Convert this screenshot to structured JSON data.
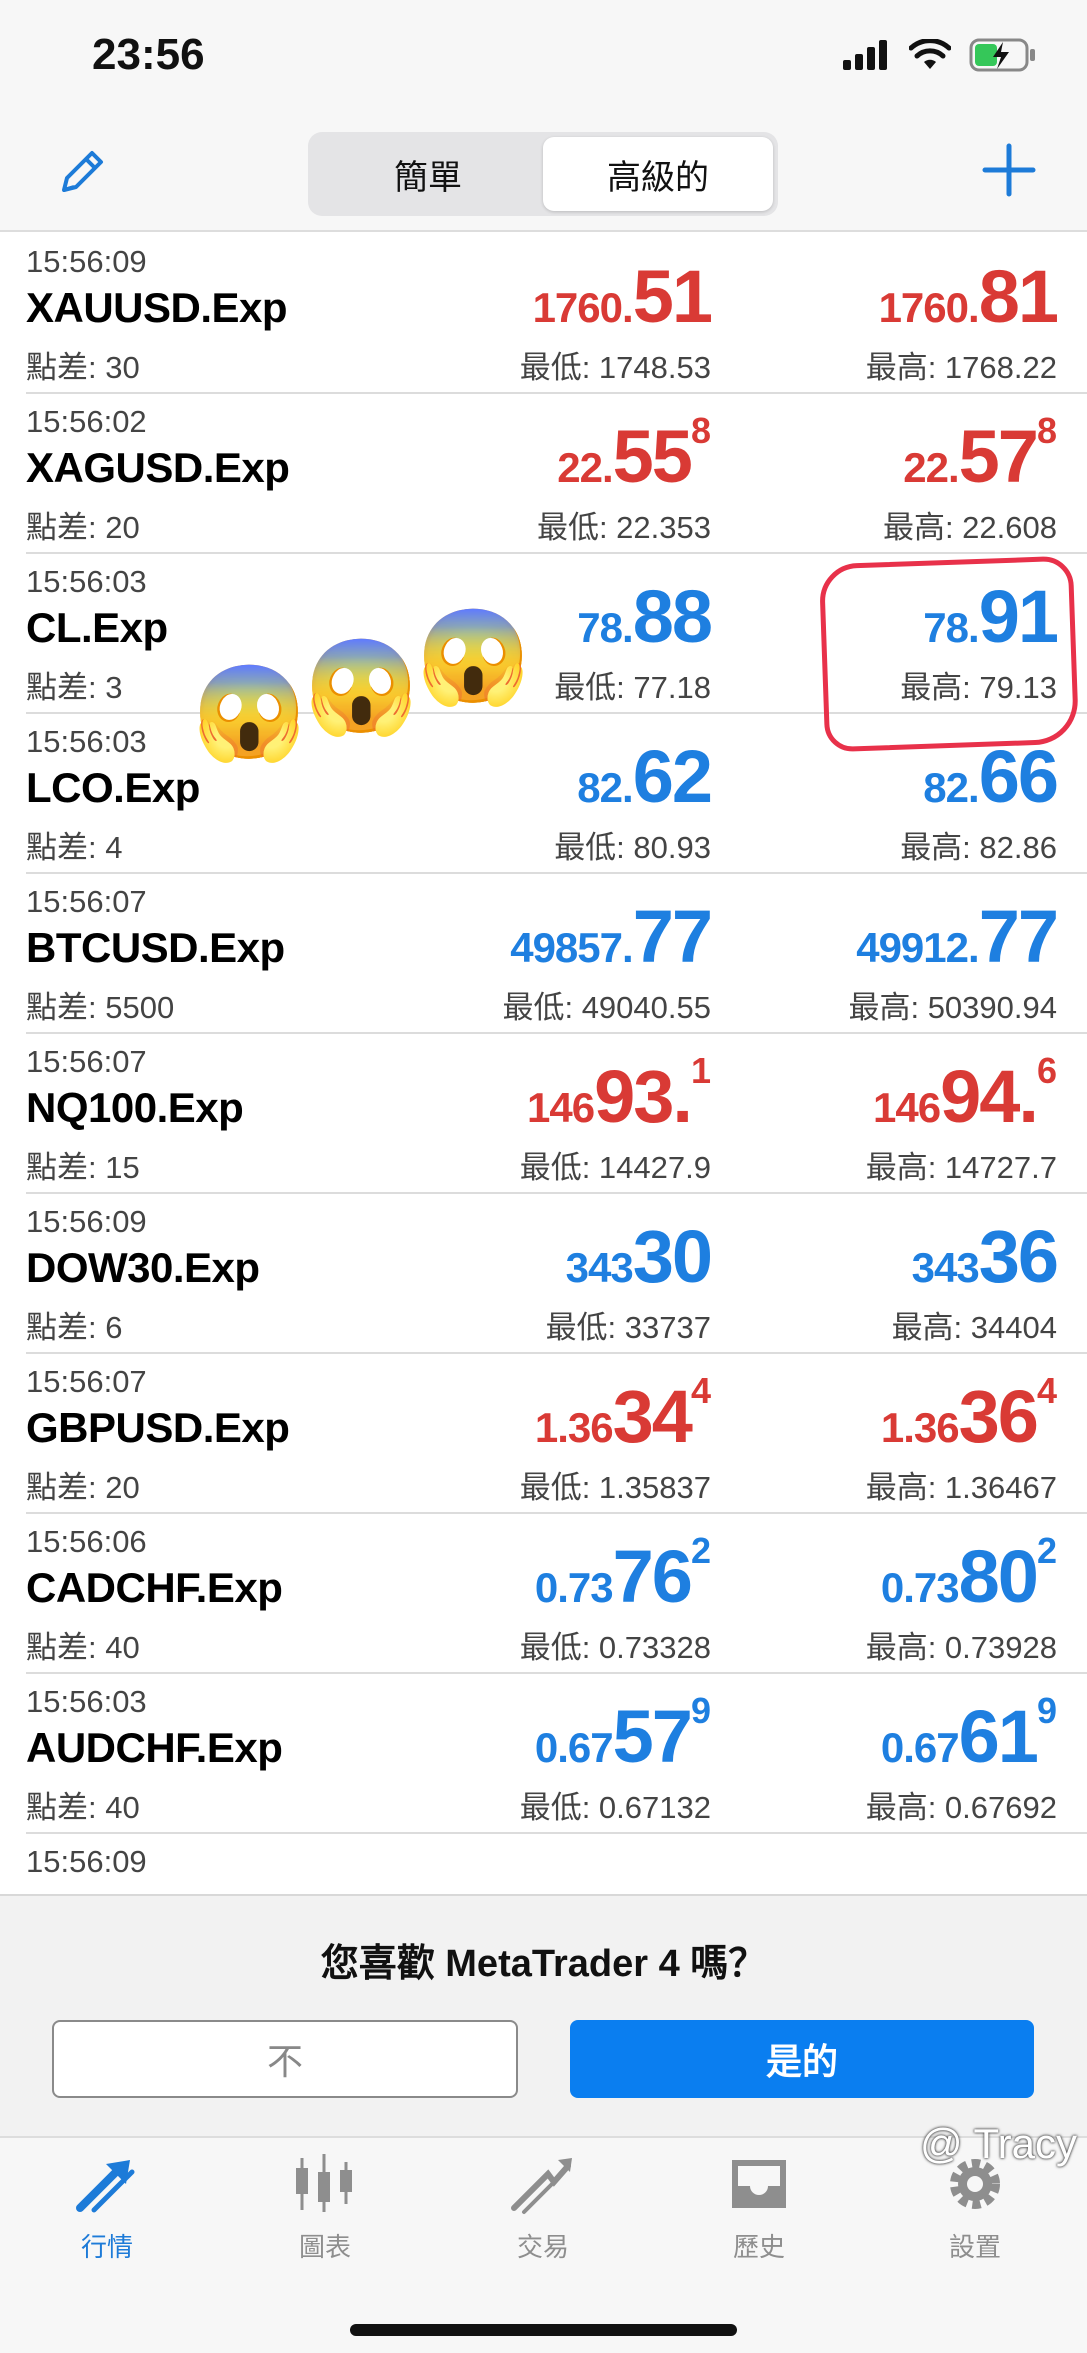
{
  "status_bar": {
    "time": "23:56"
  },
  "nav": {
    "segments": [
      "簡單",
      "高級的"
    ],
    "active_segment": 1
  },
  "colors": {
    "red": "#d93a35",
    "blue": "#1e7fe0",
    "accent": "#0a7ef0",
    "annotation": "#e8314a"
  },
  "quotes": [
    {
      "time": "15:56:09",
      "symbol": "XAUUSD.Exp",
      "spread": "點差: 30",
      "color": "red",
      "bid": {
        "small": "1760.",
        "big": "51",
        "sup": ""
      },
      "ask": {
        "small": "1760.",
        "big": "81",
        "sup": ""
      },
      "low": "最低: 1748.53",
      "high": "最高: 1768.22"
    },
    {
      "time": "15:56:02",
      "symbol": "XAGUSD.Exp",
      "spread": "點差: 20",
      "color": "red",
      "bid": {
        "small": "22.",
        "big": "55",
        "sup": "8"
      },
      "ask": {
        "small": "22.",
        "big": "57",
        "sup": "8"
      },
      "low": "最低: 22.353",
      "high": "最高: 22.608"
    },
    {
      "time": "15:56:03",
      "symbol": "CL.Exp",
      "spread": "點差: 3",
      "color": "blue",
      "bid": {
        "small": "78.",
        "big": "88",
        "sup": ""
      },
      "ask": {
        "small": "78.",
        "big": "91",
        "sup": ""
      },
      "low": "最低: 77.18",
      "high": "最高: 79.13"
    },
    {
      "time": "15:56:03",
      "symbol": "LCO.Exp",
      "spread": "點差: 4",
      "color": "blue",
      "bid": {
        "small": "82.",
        "big": "62",
        "sup": ""
      },
      "ask": {
        "small": "82.",
        "big": "66",
        "sup": ""
      },
      "low": "最低: 80.93",
      "high": "最高: 82.86"
    },
    {
      "time": "15:56:07",
      "symbol": "BTCUSD.Exp",
      "spread": "點差: 5500",
      "color": "blue",
      "bid": {
        "small": "49857.",
        "big": "77",
        "sup": ""
      },
      "ask": {
        "small": "49912.",
        "big": "77",
        "sup": ""
      },
      "low": "最低: 49040.55",
      "high": "最高: 50390.94"
    },
    {
      "time": "15:56:07",
      "symbol": "NQ100.Exp",
      "spread": "點差: 15",
      "color": "red",
      "bid": {
        "small": "146",
        "big": "93.",
        "sup": "1"
      },
      "ask": {
        "small": "146",
        "big": "94.",
        "sup": "6"
      },
      "low": "最低: 14427.9",
      "high": "最高: 14727.7"
    },
    {
      "time": "15:56:09",
      "symbol": "DOW30.Exp",
      "spread": "點差: 6",
      "color": "blue",
      "bid": {
        "small": "343",
        "big": "30",
        "sup": ""
      },
      "ask": {
        "small": "343",
        "big": "36",
        "sup": ""
      },
      "low": "最低: 33737",
      "high": "最高: 34404"
    },
    {
      "time": "15:56:07",
      "symbol": "GBPUSD.Exp",
      "spread": "點差: 20",
      "color": "red",
      "bid": {
        "small": "1.36",
        "big": "34",
        "sup": "4"
      },
      "ask": {
        "small": "1.36",
        "big": "36",
        "sup": "4"
      },
      "low": "最低: 1.35837",
      "high": "最高: 1.36467"
    },
    {
      "time": "15:56:06",
      "symbol": "CADCHF.Exp",
      "spread": "點差: 40",
      "color": "blue",
      "bid": {
        "small": "0.73",
        "big": "76",
        "sup": "2"
      },
      "ask": {
        "small": "0.73",
        "big": "80",
        "sup": "2"
      },
      "low": "最低: 0.73328",
      "high": "最高: 0.73928"
    },
    {
      "time": "15:56:03",
      "symbol": "AUDCHF.Exp",
      "spread": "點差: 40",
      "color": "blue",
      "bid": {
        "small": "0.67",
        "big": "57",
        "sup": "9"
      },
      "ask": {
        "small": "0.67",
        "big": "61",
        "sup": "9"
      },
      "low": "最低: 0.67132",
      "high": "最高: 0.67692"
    },
    {
      "time": "15:56:09",
      "symbol": "",
      "spread": "",
      "color": "red",
      "bid": {
        "small": "",
        "big": "",
        "sup": ""
      },
      "ask": {
        "small": "",
        "big": "",
        "sup": ""
      },
      "low": "",
      "high": ""
    }
  ],
  "rating": {
    "question": "您喜歡 MetaTrader 4 嗎？",
    "no_label": "不",
    "yes_label": "是的"
  },
  "tabbar": {
    "items": [
      "行情",
      "圖表",
      "交易",
      "歷史",
      "設置"
    ],
    "active": 0
  },
  "annotations": {
    "emoji": "😱"
  },
  "watermark": "@ Tracy"
}
